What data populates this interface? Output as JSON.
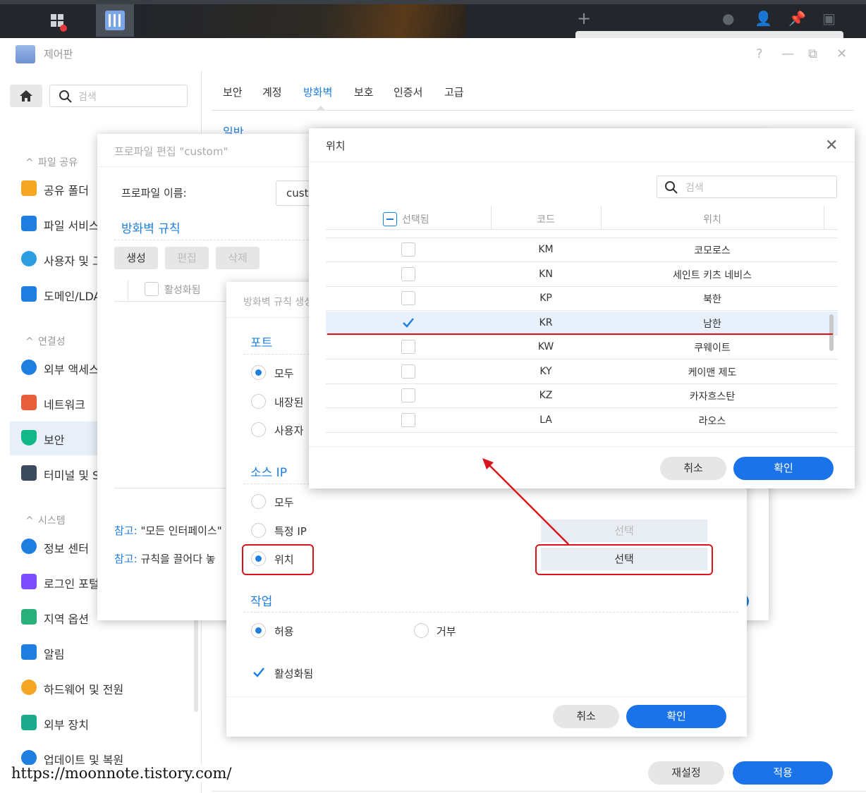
{
  "window": {
    "title": "제어판",
    "controls": [
      "?",
      "—",
      "⧉",
      "✕"
    ]
  },
  "sidebar": {
    "search_placeholder": "검색",
    "sections": {
      "file_sharing": "파일 공유",
      "connectivity": "연결성",
      "system": "시스템"
    },
    "items": [
      {
        "label": "공유 폴더",
        "color": "#f5a623"
      },
      {
        "label": "파일 서비스",
        "color": "#1e7fe0"
      },
      {
        "label": "사용자 및 그룹",
        "color": "#2d9ee0"
      },
      {
        "label": "도메인/LDAP",
        "color": "#1e7fe0"
      },
      {
        "label": "외부 액세스",
        "color": "#1e7fe0"
      },
      {
        "label": "네트워크",
        "color": "#e85d3a"
      },
      {
        "label": "보안",
        "color": "#12b886"
      },
      {
        "label": "터미널 및 SNMP",
        "color": "#3b4a5c"
      },
      {
        "label": "정보 센터",
        "color": "#1e7fe0"
      },
      {
        "label": "로그인 포털",
        "color": "#7c4dff"
      },
      {
        "label": "지역 옵션",
        "color": "#2ab07a"
      },
      {
        "label": "알림",
        "color": "#1e7fe0"
      },
      {
        "label": "하드웨어 및 전원",
        "color": "#f5a623"
      },
      {
        "label": "외부 장치",
        "color": "#1eaa8c"
      },
      {
        "label": "업데이트 및 복원",
        "color": "#1e7fe0"
      }
    ]
  },
  "tabs": [
    "보안",
    "계정",
    "방화벽",
    "보호",
    "인증서",
    "고급"
  ],
  "active_tab": "방화벽",
  "subsection": "일반",
  "profile_dialog": {
    "title": "프로파일 편집 \"custom\"",
    "name_label": "프로파일 이름:",
    "name_value": "custom",
    "rules_heading": "방화벽 규칙",
    "buttons": {
      "create": "생성",
      "edit": "편집",
      "delete": "삭제"
    },
    "col_enabled": "활성화됨",
    "note1_prefix": "참고:",
    "note1_text": "\"모든 인터페이스\"",
    "note2_prefix": "참고:",
    "note2_text": "규칙을 끌어다 놓"
  },
  "rule_dialog": {
    "title": "방화벽 규칙 생성",
    "port_heading": "포트",
    "port_options": [
      "모두",
      "내장된",
      "사용자"
    ],
    "source_heading": "소스 IP",
    "source_options": [
      "모두",
      "특정 IP",
      "위치"
    ],
    "select_label": "선택",
    "action_heading": "작업",
    "action_allow": "허용",
    "action_deny": "거부",
    "enabled_label": "활성화됨",
    "cancel": "취소",
    "ok": "확인"
  },
  "location_dialog": {
    "title": "위치",
    "search_placeholder": "검색",
    "col_selected": "선택됨",
    "col_code": "코드",
    "col_location": "위치",
    "rows": [
      {
        "code": "KM",
        "name": "코모로스",
        "checked": false
      },
      {
        "code": "KN",
        "name": "세인트 키츠 네비스",
        "checked": false
      },
      {
        "code": "KP",
        "name": "북한",
        "checked": false
      },
      {
        "code": "KR",
        "name": "남한",
        "checked": true
      },
      {
        "code": "KW",
        "name": "쿠웨이트",
        "checked": false
      },
      {
        "code": "KY",
        "name": "케이맨 제도",
        "checked": false
      },
      {
        "code": "KZ",
        "name": "카자흐스탄",
        "checked": false
      },
      {
        "code": "LA",
        "name": "라오스",
        "checked": false
      }
    ],
    "cancel": "취소",
    "ok": "확인"
  },
  "footer": {
    "reset": "재설정",
    "apply": "적용"
  },
  "watermark": "https://moonnote.tistory.com/",
  "colors": {
    "accent": "#1e7fe0",
    "primary_button": "#1a73e8",
    "highlight_red": "#d8141e"
  }
}
